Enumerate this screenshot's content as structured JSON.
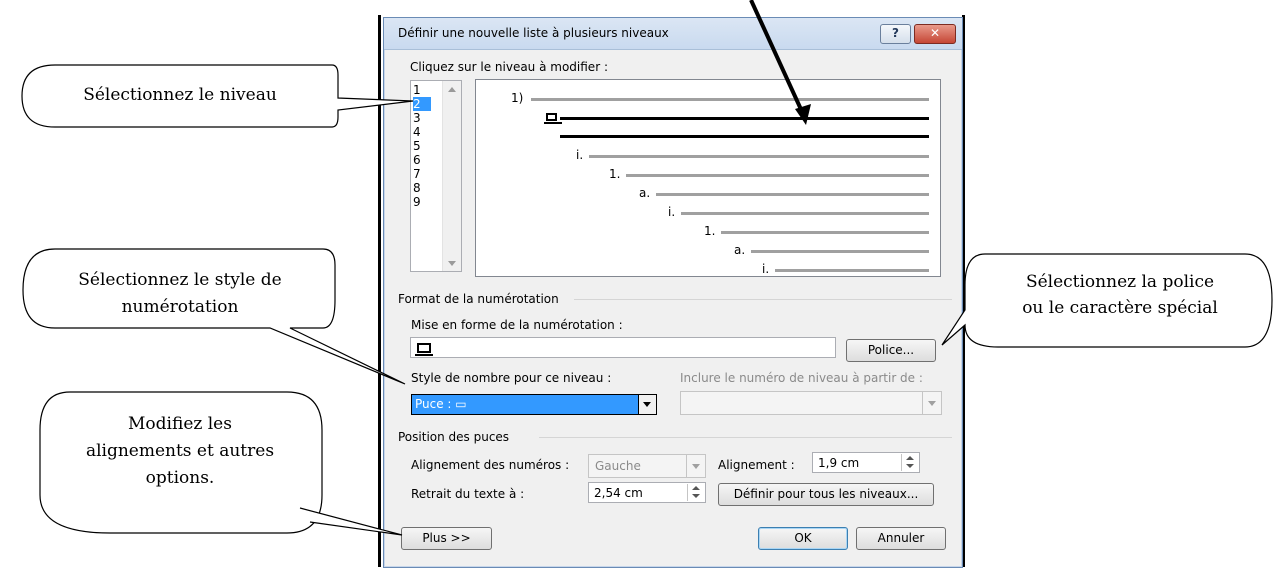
{
  "dialog": {
    "title": "Définir une nouvelle liste à plusieurs niveaux",
    "help_label": "?",
    "close_label": "✕",
    "level_prompt": "Cliquez sur le niveau à modifier :",
    "levels": [
      "1",
      "2",
      "3",
      "4",
      "5",
      "6",
      "7",
      "8",
      "9"
    ],
    "selected_level": "2",
    "preview_labels": [
      "1)",
      "i.",
      "1.",
      "a.",
      "i.",
      "1.",
      "a.",
      "i."
    ],
    "format_group": "Format de la numérotation",
    "format_label": "Mise en forme de la numérotation :",
    "font_button": "Police...",
    "number_style_label": "Style de nombre pour ce niveau :",
    "number_style_value": "Puce : ▭",
    "include_level_label": "Inclure le numéro de niveau à partir de :",
    "position_group": "Position des puces",
    "number_alignment_label": "Alignement des numéros :",
    "number_alignment_value": "Gauche",
    "alignment_label": "Alignement :",
    "alignment_value": "1,9 cm",
    "text_indent_label": "Retrait du texte à :",
    "text_indent_value": "2,54 cm",
    "set_all_levels_button": "Définir pour tous les niveaux...",
    "more_button": "Plus >>",
    "ok_button": "OK",
    "cancel_button": "Annuler"
  },
  "callouts": {
    "select_level": "Sélectionnez le niveau",
    "select_style_1": "Sélectionnez le style de",
    "select_style_2": "numérotation",
    "select_font_1": "Sélectionnez la police",
    "select_font_2": "ou le caractère spécial",
    "modify_1": "Modifiez les",
    "modify_2": "alignements et autres",
    "modify_3": "options."
  }
}
